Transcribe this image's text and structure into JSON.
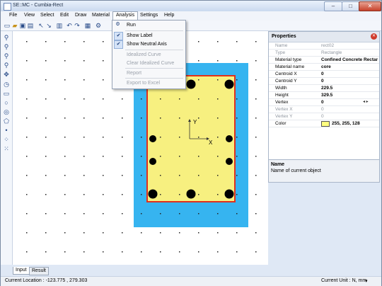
{
  "window": {
    "title": "SE::MC - Cumbia-Rect",
    "min": "–",
    "max": "□",
    "close": "✕"
  },
  "menu": [
    "File",
    "View",
    "Select",
    "Edit",
    "Draw",
    "Material",
    "Analysis",
    "Settings",
    "Help"
  ],
  "analysis_menu": {
    "run": "Run",
    "show_label": "Show Label",
    "show_neutral_axis": "Show Neutral Axis",
    "idealized_curve": "Idealized Curve",
    "clear_idealized_curve": "Clear Idealized Curve",
    "report": "Report",
    "export_excel": "Export to Excel"
  },
  "toolbar_icons": [
    "new-icon",
    "open-icon",
    "save-icon",
    "print-icon",
    "select-icon",
    "select-node-icon",
    "delete-icon",
    "undo-icon",
    "redo-icon",
    "calculator-icon",
    "analysis-icon"
  ],
  "left_tools": [
    "zoom-in-icon",
    "zoom-out-icon",
    "zoom-window-icon",
    "zoom-fit-icon",
    "pan-icon",
    "rotate-icon",
    "rectangle-icon",
    "circle-icon",
    "ring-icon",
    "polygon-icon",
    "point-icon",
    "circular-pattern-icon",
    "rect-pattern-icon"
  ],
  "axes": {
    "x": "X",
    "y": "Y"
  },
  "properties": {
    "title": "Properties",
    "rows": [
      {
        "name": "Name",
        "value": "rect02",
        "disabled": true
      },
      {
        "name": "Type",
        "value": "Rectangle",
        "disabled": true
      },
      {
        "name": "Material type",
        "value": "Confined Concrete Rectan",
        "disabled": false
      },
      {
        "name": "Material name",
        "value": "core",
        "disabled": false
      },
      {
        "name": "Centroid  X",
        "value": "0",
        "disabled": false
      },
      {
        "name": "Centroid  Y",
        "value": "0",
        "disabled": false
      },
      {
        "name": "Width",
        "value": "229.5",
        "disabled": false
      },
      {
        "name": "Height",
        "value": "329.5",
        "disabled": false
      },
      {
        "name": "Vertex",
        "value": "0",
        "disabled": false
      },
      {
        "name": "Vertex X",
        "value": "0",
        "disabled": true
      },
      {
        "name": "Vertex Y",
        "value": "0",
        "disabled": true
      },
      {
        "name": "Color",
        "value": "255, 255, 128",
        "disabled": false
      }
    ],
    "color_swatch": "#ffff80"
  },
  "description": {
    "title": "Name",
    "text": "Name of current object"
  },
  "tabs": [
    "Input",
    "Result"
  ],
  "status": {
    "location": "Current Location :  -123.775 , 279.303",
    "unit": "Current Unit :    N, mm"
  },
  "colors": {
    "cover": "#36b4f0",
    "core": "#f7f080",
    "core_border": "#e0301c",
    "rebar": "#000000"
  }
}
